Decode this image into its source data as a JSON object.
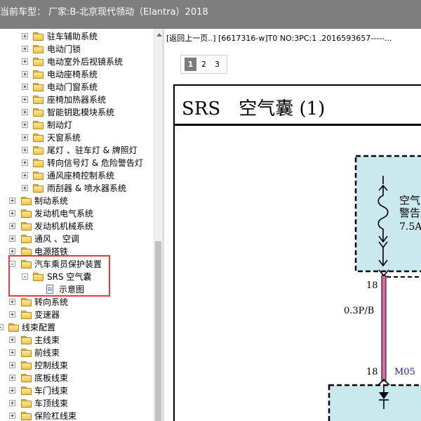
{
  "window": {
    "title": "当前车型：  厂家:B-北京现代领动（Elantra）2018"
  },
  "tree": {
    "items": [
      {
        "label": "驻车辅助系统",
        "expander": "+"
      },
      {
        "label": "电动门锁",
        "expander": "+"
      },
      {
        "label": "电动室外后视镜系统",
        "expander": "+"
      },
      {
        "label": "电动座椅系统",
        "expander": "+"
      },
      {
        "label": "电动门窗系统",
        "expander": "+"
      },
      {
        "label": "座椅加热器系统",
        "expander": "+"
      },
      {
        "label": "智能钥匙模块系统",
        "expander": "+"
      },
      {
        "label": "制动灯",
        "expander": "+"
      },
      {
        "label": "天窗系统",
        "expander": "+"
      },
      {
        "label": "尾灯 、驻车灯 & 牌照灯",
        "expander": "+"
      },
      {
        "label": "转向信号灯 & 危险警告灯",
        "expander": "+"
      },
      {
        "label": "通风座椅控制系统",
        "expander": "+"
      },
      {
        "label": "雨刮器 & 喷水器系统",
        "expander": "+"
      },
      {
        "label": "制动系统",
        "expander": "+"
      },
      {
        "label": "发动机电气系统",
        "expander": "+"
      },
      {
        "label": "发动机机械系统",
        "expander": "+"
      },
      {
        "label": "通风 、空调",
        "expander": "+"
      },
      {
        "label": "电源搭铁",
        "expander": "+"
      },
      {
        "label": "汽车乘员保护装置",
        "expander": "-"
      },
      {
        "label": "SRS 空气囊",
        "expander": "-"
      },
      {
        "label": "示意图",
        "expander": ""
      },
      {
        "label": "转向系统",
        "expander": "+"
      },
      {
        "label": "变速器",
        "expander": "+"
      },
      {
        "label": "线束配置",
        "expander": "-"
      },
      {
        "label": "主线束",
        "expander": "+"
      },
      {
        "label": "前线束",
        "expander": "+"
      },
      {
        "label": "控制线束",
        "expander": "+"
      },
      {
        "label": "底板线束",
        "expander": "+"
      },
      {
        "label": "车门线束",
        "expander": "+"
      },
      {
        "label": "车顶线束",
        "expander": "+"
      },
      {
        "label": "保险杠线束",
        "expander": "+"
      }
    ]
  },
  "content": {
    "breadcrumb": "[返回上一页..] [6617316-w]T0 NO:3PC:1 .2016593657-----...",
    "pages": [
      "1",
      "2",
      "3"
    ],
    "active_page": "1",
    "diagram": {
      "title": "SRS　空气囊 (1)",
      "fuse_label_1": "空气",
      "fuse_label_2": "警告",
      "fuse_rating": "7.5A",
      "pin_top": "18",
      "wire_spec": "0.3P/B",
      "pin_bottom": "18",
      "connector": "M05"
    }
  },
  "colors": {
    "titlebar": "#7e7e7e",
    "highlight_box": "#e53a3a",
    "fuse_box_fill": "#c9e9ee",
    "wire": "#e06aaa",
    "connector_text": "#1a1aa0"
  }
}
